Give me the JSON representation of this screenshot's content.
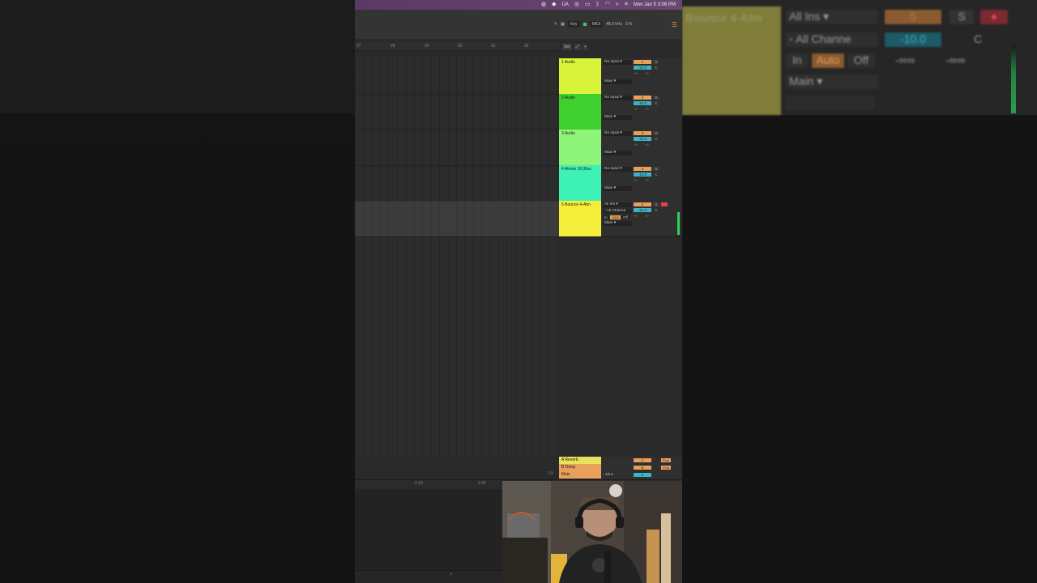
{
  "menubar": {
    "ua": "UA",
    "clock": "Mon Jan 5 3:06 PM"
  },
  "toolbar": {
    "key": "Key",
    "midi": "MIDI",
    "sample_rate": "48.0 kHz",
    "cpu": "3 %"
  },
  "ruler": {
    "marks": [
      "27",
      "28",
      "29",
      "30",
      "31",
      "32"
    ]
  },
  "set_label": "Set",
  "tracks": [
    {
      "title": "1 Audio",
      "color": "#d8f33a",
      "input": "No input",
      "output": "Main",
      "number": "1",
      "volume": "-10.0",
      "pan": "C"
    },
    {
      "title": "2 Audio",
      "color": "#3fcf2e",
      "input": "No input",
      "output": "Main",
      "number": "2",
      "volume": "-10.0",
      "pan": "C"
    },
    {
      "title": "3 Audio",
      "color": "#8ff57a",
      "input": "No input",
      "output": "Main",
      "number": "3",
      "volume": "-10.0",
      "pan": "C"
    },
    {
      "title": "4 Atmos 18 (Bou",
      "color": "#3ef2b6",
      "input": "No input",
      "output": "Main",
      "number": "4",
      "volume": "-10.0",
      "pan": "C"
    },
    {
      "title": "5 Bounce 4-Atm",
      "color": "#f4ee3a",
      "input": "All Ins",
      "channel": "All Channe",
      "output": "Main",
      "number": "5",
      "volume": "-10.0",
      "pan": "C",
      "monitor": [
        "In",
        "Auto",
        "Off"
      ]
    }
  ],
  "returns": [
    {
      "name": "A Reverb",
      "color": "#e8e25a",
      "label": "A",
      "post": "Post"
    },
    {
      "name": "B Delay",
      "color": "#e8a05a",
      "label": "B",
      "post": "Post"
    },
    {
      "name": "Main",
      "color": "#e8a05a",
      "out": "1/2",
      "value": "0"
    }
  ],
  "lower_ruler": [
    "1:10",
    "1:20"
  ],
  "right_blur": {
    "track_name": "Bounce 4-Atm",
    "input": "All Ins",
    "channel": "All Channe",
    "in": "In",
    "auto": "Auto",
    "off": "Off",
    "output": "Main",
    "number": "5",
    "s": "S",
    "volume": "-10.0",
    "pan": "C",
    "inf1": "-∞∞",
    "inf2": "-∞∞"
  },
  "inf_text": "-∞",
  "fraction": "1/4"
}
